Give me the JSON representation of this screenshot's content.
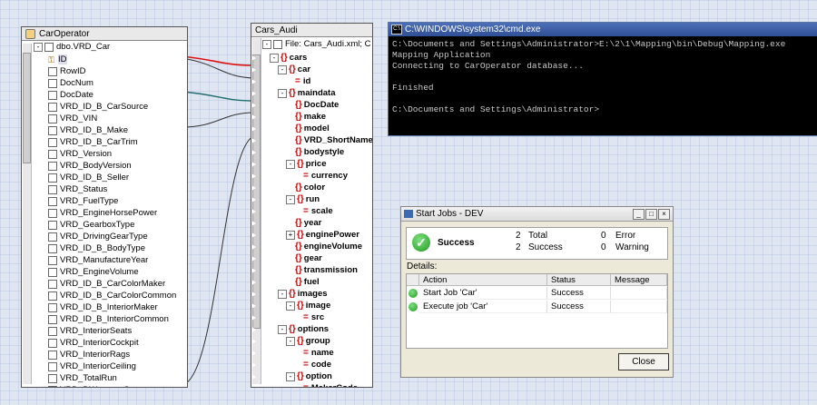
{
  "car_operator": {
    "title": "CarOperator",
    "table": "dbo.VRD_Car",
    "fields": [
      "ID",
      "RowID",
      "DocNum",
      "DocDate",
      "VRD_ID_B_CarSource",
      "VRD_VIN",
      "VRD_ID_B_Make",
      "VRD_ID_B_CarTrim",
      "VRD_Version",
      "VRD_BodyVersion",
      "VRD_ID_B_Seller",
      "VRD_Status",
      "VRD_FuelType",
      "VRD_EngineHorsePower",
      "VRD_GearboxType",
      "VRD_DrivingGearType",
      "VRD_ID_B_BodyType",
      "VRD_ManufactureYear",
      "VRD_EngineVolume",
      "VRD_ID_B_CarColorMaker",
      "VRD_ID_B_CarColorCommon",
      "VRD_ID_B_InteriorMaker",
      "VRD_ID_B_InteriorCommon",
      "VRD_InteriorSeats",
      "VRD_InteriorCockpit",
      "VRD_InteriorRags",
      "VRD_InteriorCeiling",
      "VRD_TotalRun",
      "VRD_DWarrantyStart"
    ]
  },
  "cars_audi": {
    "title": "Cars_Audi",
    "file": "File: Cars_Audi.xml; C",
    "nodes": [
      {
        "label": "cars",
        "kind": "elem",
        "exp": "-"
      },
      {
        "label": "car",
        "kind": "elem",
        "exp": "-"
      },
      {
        "label": "id",
        "kind": "attr",
        "exp": ""
      },
      {
        "label": "maindata",
        "kind": "elem",
        "exp": "-"
      },
      {
        "label": "DocDate",
        "kind": "elem",
        "exp": ""
      },
      {
        "label": "make",
        "kind": "elem",
        "exp": ""
      },
      {
        "label": "model",
        "kind": "elem",
        "exp": ""
      },
      {
        "label": "VRD_ShortName",
        "kind": "elem",
        "exp": ""
      },
      {
        "label": "bodystyle",
        "kind": "elem",
        "exp": ""
      },
      {
        "label": "price",
        "kind": "elem",
        "exp": "-"
      },
      {
        "label": "currency",
        "kind": "attr",
        "exp": ""
      },
      {
        "label": "color",
        "kind": "elem",
        "exp": ""
      },
      {
        "label": "run",
        "kind": "elem",
        "exp": "-"
      },
      {
        "label": "scale",
        "kind": "attr",
        "exp": ""
      },
      {
        "label": "year",
        "kind": "elem",
        "exp": ""
      },
      {
        "label": "enginePower",
        "kind": "elem",
        "exp": "+"
      },
      {
        "label": "engineVolume",
        "kind": "elem",
        "exp": ""
      },
      {
        "label": "gear",
        "kind": "elem",
        "exp": ""
      },
      {
        "label": "transmission",
        "kind": "elem",
        "exp": ""
      },
      {
        "label": "fuel",
        "kind": "elem",
        "exp": ""
      },
      {
        "label": "images",
        "kind": "elem",
        "exp": "-"
      },
      {
        "label": "image",
        "kind": "elem",
        "exp": "-"
      },
      {
        "label": "src",
        "kind": "attr",
        "exp": ""
      },
      {
        "label": "options",
        "kind": "elem",
        "exp": "-"
      },
      {
        "label": "group",
        "kind": "elem",
        "exp": "-"
      },
      {
        "label": "name",
        "kind": "attr",
        "exp": ""
      },
      {
        "label": "code",
        "kind": "attr",
        "exp": ""
      },
      {
        "label": "option",
        "kind": "elem",
        "exp": "-"
      },
      {
        "label": "MakerCode",
        "kind": "attr",
        "exp": ""
      }
    ]
  },
  "cmd": {
    "title": "C:\\WINDOWS\\system32\\cmd.exe",
    "output": "C:\\Documents and Settings\\Administrator>E:\\2\\1\\Mapping\\bin\\Debug\\Mapping.exe\nMapping Application\nConnecting to CarOperator database...\n\nFinished\n\nC:\\Documents and Settings\\Administrator>"
  },
  "dialog": {
    "title": "Start Jobs - DEV",
    "status": "Success",
    "total_count": "2",
    "total_label": "Total",
    "success_count": "2",
    "success_label": "Success",
    "error_count": "0",
    "error_label": "Error",
    "warning_count": "0",
    "warning_label": "Warning",
    "details_label": "Details:",
    "columns": [
      "Action",
      "Status",
      "Message"
    ],
    "rows": [
      {
        "action": "Start Job 'Car'",
        "status": "Success",
        "message": ""
      },
      {
        "action": "Execute job 'Car'",
        "status": "Success",
        "message": ""
      }
    ],
    "close_label": "Close"
  },
  "colors": {
    "cmd_bg": "#000000",
    "accent": "#2f4f97",
    "mapping_red": "#e01010",
    "mapping_teal": "#1f6f6f"
  }
}
